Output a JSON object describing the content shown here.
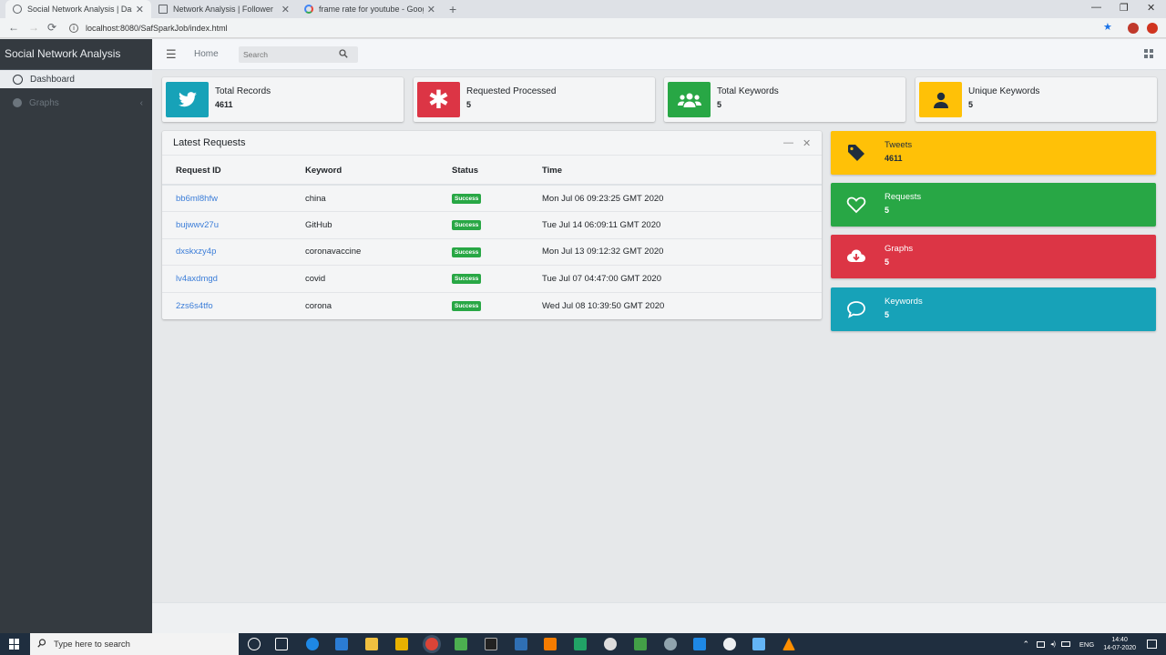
{
  "browser": {
    "tabs": [
      {
        "title": "Social Network Analysis | Dashb",
        "active": true,
        "color": "#5f6368"
      },
      {
        "title": "Network Analysis | Follower",
        "active": false,
        "color": "#5f6368"
      },
      {
        "title": "frame rate for youtube - Google",
        "active": false,
        "color": "#4285f4"
      }
    ],
    "new_tab": "+",
    "minimize": "—",
    "restore": "❐",
    "close": "✕",
    "back": "←",
    "forward": "→",
    "reload": "⟳",
    "url": "localhost:8080/SafSparkJob/index.html"
  },
  "sidebar": {
    "brand": "Social Network Analysis",
    "items": [
      {
        "label": "Dashboard",
        "active": true
      },
      {
        "label": "Graphs",
        "active": false
      }
    ]
  },
  "header": {
    "menu": "☰",
    "home": "Home",
    "search_placeholder": "Search"
  },
  "info_boxes": [
    {
      "label": "Total Records",
      "value": "4611",
      "color": "#17a2b8",
      "icon": "twitter-icon"
    },
    {
      "label": "Requested Processed",
      "value": "5",
      "color": "#dc3545",
      "icon": "asterisk-icon"
    },
    {
      "label": "Total Keywords",
      "value": "5",
      "color": "#28a745",
      "icon": "users-icon"
    },
    {
      "label": "Unique Keywords",
      "value": "5",
      "color": "#ffc107",
      "icon": "user-icon"
    }
  ],
  "latest_requests": {
    "title": "Latest Requests",
    "minimize": "—",
    "close": "✕",
    "columns": [
      "Request ID",
      "Keyword",
      "Status",
      "Time"
    ],
    "rows": [
      {
        "id": "bb6ml8hfw",
        "keyword": "china",
        "status": "Success",
        "time": "Mon Jul 06 09:23:25 GMT 2020"
      },
      {
        "id": "bujwwv27u",
        "keyword": "GitHub",
        "status": "Success",
        "time": "Tue Jul 14 06:09:11 GMT 2020"
      },
      {
        "id": "dxskxzy4p",
        "keyword": "coronavaccine",
        "status": "Success",
        "time": "Mon Jul 13 09:12:32 GMT 2020"
      },
      {
        "id": "lv4axdmgd",
        "keyword": "covid",
        "status": "Success",
        "time": "Tue Jul 07 04:47:00 GMT 2020"
      },
      {
        "id": "2zs6s4tfo",
        "keyword": "corona",
        "status": "Success",
        "time": "Wed Jul 08 10:39:50 GMT 2020"
      }
    ]
  },
  "stat_boxes": [
    {
      "label": "Tweets",
      "value": "4611",
      "color": "#ffc107",
      "text_color": "#1f2d3d",
      "icon": "tag-icon"
    },
    {
      "label": "Requests",
      "value": "5",
      "color": "#28a745",
      "text_color": "#ffffff",
      "icon": "heart-icon"
    },
    {
      "label": "Graphs",
      "value": "5",
      "color": "#dc3545",
      "text_color": "#ffffff",
      "icon": "cloud-download-icon"
    },
    {
      "label": "Keywords",
      "value": "5",
      "color": "#17a2b8",
      "text_color": "#ffffff",
      "icon": "comment-icon"
    }
  ],
  "taskbar": {
    "search": "Type here to search",
    "lang": "ENG",
    "time": "14:40",
    "date": "14-07-2020"
  }
}
